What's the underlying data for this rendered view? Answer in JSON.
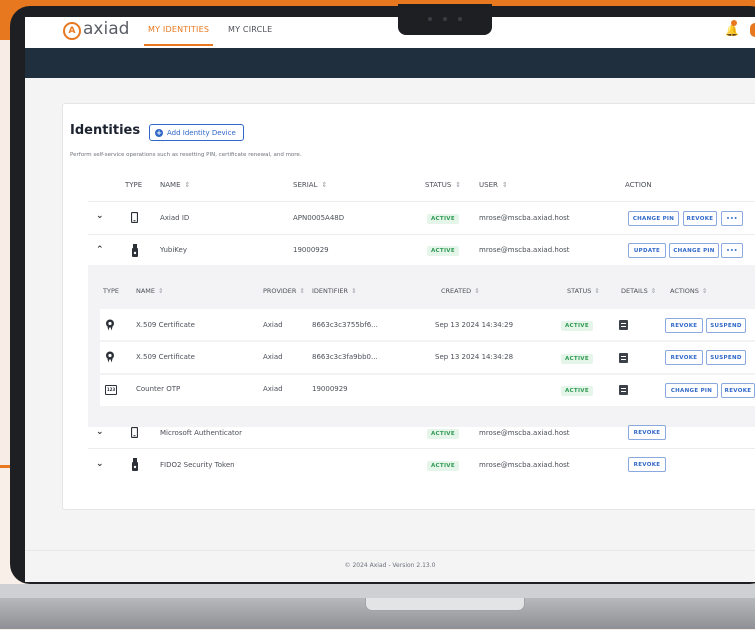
{
  "brand": {
    "logo_letter": "A",
    "name": "axiad",
    "accent": "#e8781f"
  },
  "nav": {
    "tab_active": "MY IDENTITIES",
    "tab_other": "MY CIRCLE",
    "notification_count": "1"
  },
  "page": {
    "title": "Identities",
    "add_button": "Add Identity Device",
    "subtitle": "Perform self-service operations such as resetting PIN, certificate renewal, and more."
  },
  "table": {
    "headers": {
      "type": "TYPE",
      "name": "NAME",
      "serial": "SERIAL",
      "status": "STATUS",
      "user": "USER",
      "action": "ACTION"
    },
    "sort_icon": "⇕",
    "rows": [
      {
        "name": "Axiad ID",
        "serial": "APN0005A48D",
        "status": "ACTIVE",
        "user": "mrose@mscba.axiad.host",
        "actions": [
          "CHANGE PIN",
          "REVOKE",
          "•••"
        ],
        "icon": "phone-icon",
        "chevron": "⌄"
      },
      {
        "name": "YubiKey",
        "serial": "19000929",
        "status": "ACTIVE",
        "user": "mrose@mscba.axiad.host",
        "actions": [
          "UPDATE",
          "CHANGE PIN",
          "•••"
        ],
        "icon": "usb-key-icon",
        "chevron": "⌃"
      },
      {
        "name": "Microsoft Authenticator",
        "serial": "",
        "status": "ACTIVE",
        "user": "mrose@mscba.axiad.host",
        "actions": [
          "REVOKE"
        ],
        "icon": "phone-icon",
        "chevron": "⌄"
      },
      {
        "name": "FIDO2 Security Token",
        "serial": "",
        "status": "ACTIVE",
        "user": "mrose@mscba.axiad.host",
        "actions": [
          "REVOKE"
        ],
        "icon": "usb-key-icon",
        "chevron": "⌄"
      }
    ]
  },
  "subtable": {
    "headers": {
      "type": "TYPE",
      "name": "NAME",
      "provider": "PROVIDER",
      "identifier": "IDENTIFIER",
      "created": "CREATED",
      "status": "STATUS",
      "details": "DETAILS",
      "actions": "ACTIONS"
    },
    "rows": [
      {
        "name": "X.509 Certificate",
        "provider": "Axiad",
        "identifier": "8663c3c3755bf6...",
        "created": "Sep 13 2024 14:34:29",
        "status": "ACTIVE",
        "actions": [
          "REVOKE",
          "SUSPEND"
        ],
        "icon": "certificate-icon"
      },
      {
        "name": "X.509 Certificate",
        "provider": "Axiad",
        "identifier": "8663c3c3fa9bb0...",
        "created": "Sep 13 2024 14:34:28",
        "status": "ACTIVE",
        "actions": [
          "REVOKE",
          "SUSPEND"
        ],
        "icon": "certificate-icon"
      },
      {
        "name": "Counter OTP",
        "provider": "Axiad",
        "identifier": "19000929",
        "created": "",
        "status": "ACTIVE",
        "actions": [
          "CHANGE PIN",
          "REVOKE"
        ],
        "icon": "otp-icon",
        "otp_label": "123"
      }
    ]
  },
  "footer": {
    "text": "© 2024 Axiad - Version 2.13.0"
  },
  "colors": {
    "primary_blue": "#2f67c7",
    "active_green": "#2e9a52",
    "header_dark": "#1f2f3e"
  }
}
